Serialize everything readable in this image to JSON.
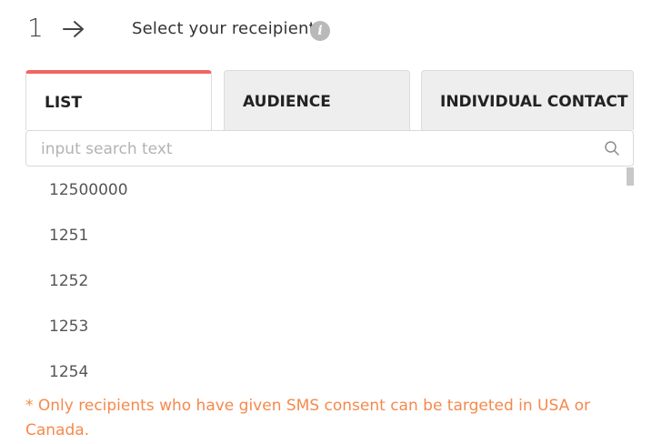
{
  "header": {
    "step_number": "1",
    "title": "Select your receipient",
    "icons": {
      "arrow": "arrow-right-icon",
      "info": "info-icon"
    },
    "info_glyph": "i"
  },
  "tabs": [
    {
      "label": "LIST",
      "active": true
    },
    {
      "label": "AUDIENCE",
      "active": false
    },
    {
      "label": "INDIVIDUAL CONTACT",
      "active": false
    }
  ],
  "search": {
    "placeholder": "input search text",
    "value": "",
    "icon": "search-icon"
  },
  "list": {
    "items": [
      "12500000",
      "1251",
      "1252",
      "1253",
      "1254"
    ]
  },
  "note": "* Only recipients who have given SMS consent can be targeted in USA or Canada.",
  "colors": {
    "accent": "#f26464",
    "note": "#f5894d",
    "tab_inactive_bg": "#eeeeee"
  }
}
